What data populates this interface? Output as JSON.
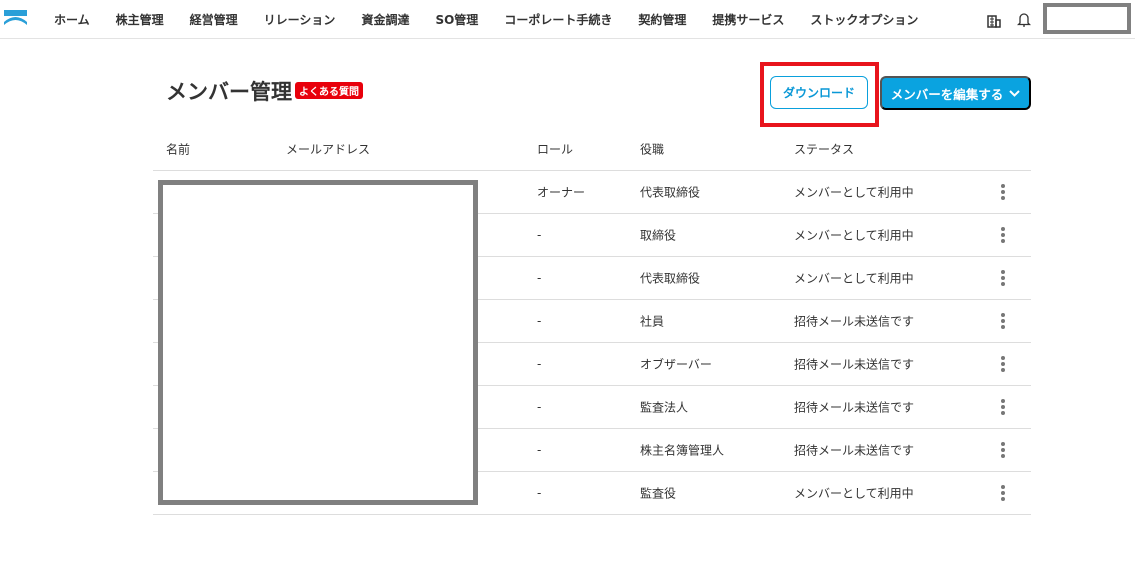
{
  "nav": {
    "items": [
      "ホーム",
      "株主管理",
      "経営管理",
      "リレーション",
      "資金調達",
      "SO管理",
      "コーポレート手続き",
      "契約管理",
      "提携サービス",
      "ストックオプション"
    ]
  },
  "page": {
    "title": "メンバー管理",
    "faq_badge": "よくある質問",
    "download_label": "ダウンロード",
    "edit_label": "メンバーを編集する"
  },
  "table": {
    "headers": {
      "name": "名前",
      "email": "メールアドレス",
      "role": "ロール",
      "position": "役職",
      "status": "ステータス"
    },
    "rows": [
      {
        "role": "オーナー",
        "position": "代表取締役",
        "status": "メンバーとして利用中"
      },
      {
        "role": "-",
        "position": "取締役",
        "status": "メンバーとして利用中"
      },
      {
        "role": "-",
        "position": "代表取締役",
        "status": "メンバーとして利用中"
      },
      {
        "role": "-",
        "position": "社員",
        "status": "招待メール未送信です"
      },
      {
        "role": "-",
        "position": "オブザーバー",
        "status": "招待メール未送信です"
      },
      {
        "role": "-",
        "position": "監査法人",
        "status": "招待メール未送信です"
      },
      {
        "role": "-",
        "position": "株主名簿管理人",
        "status": "招待メール未送信です"
      },
      {
        "role": "-",
        "position": "監査役",
        "status": "メンバーとして利用中"
      }
    ]
  }
}
